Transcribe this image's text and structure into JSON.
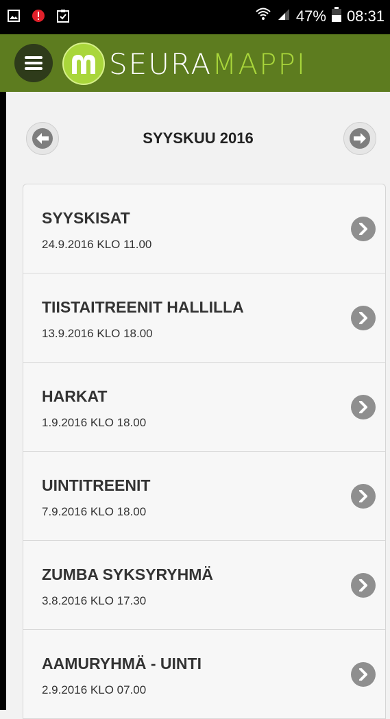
{
  "statusbar": {
    "battery": "47%",
    "time": "08:31"
  },
  "app": {
    "logo_text_a": "SEURA",
    "logo_text_b": "MAPPI",
    "reg_mark": "®",
    "accent": "#a9d63b",
    "brand": "#5d7c1f"
  },
  "calendar": {
    "month_label": "SYYSKUU 2016"
  },
  "events": [
    {
      "title": "SYYSKISAT",
      "date": "24.9.2016 KLO 11.00"
    },
    {
      "title": "TIISTAITREENIT HALLILLA",
      "date": "13.9.2016 KLO 18.00"
    },
    {
      "title": "HARKAT",
      "date": "1.9.2016 KLO 18.00"
    },
    {
      "title": "UINTITREENIT",
      "date": "7.9.2016 KLO 18.00"
    },
    {
      "title": "ZUMBA SYKSYRYHMÄ",
      "date": "3.8.2016 KLO 17.30"
    },
    {
      "title": "AAMURYHMÄ - UINTI",
      "date": "2.9.2016 KLO 07.00"
    }
  ]
}
